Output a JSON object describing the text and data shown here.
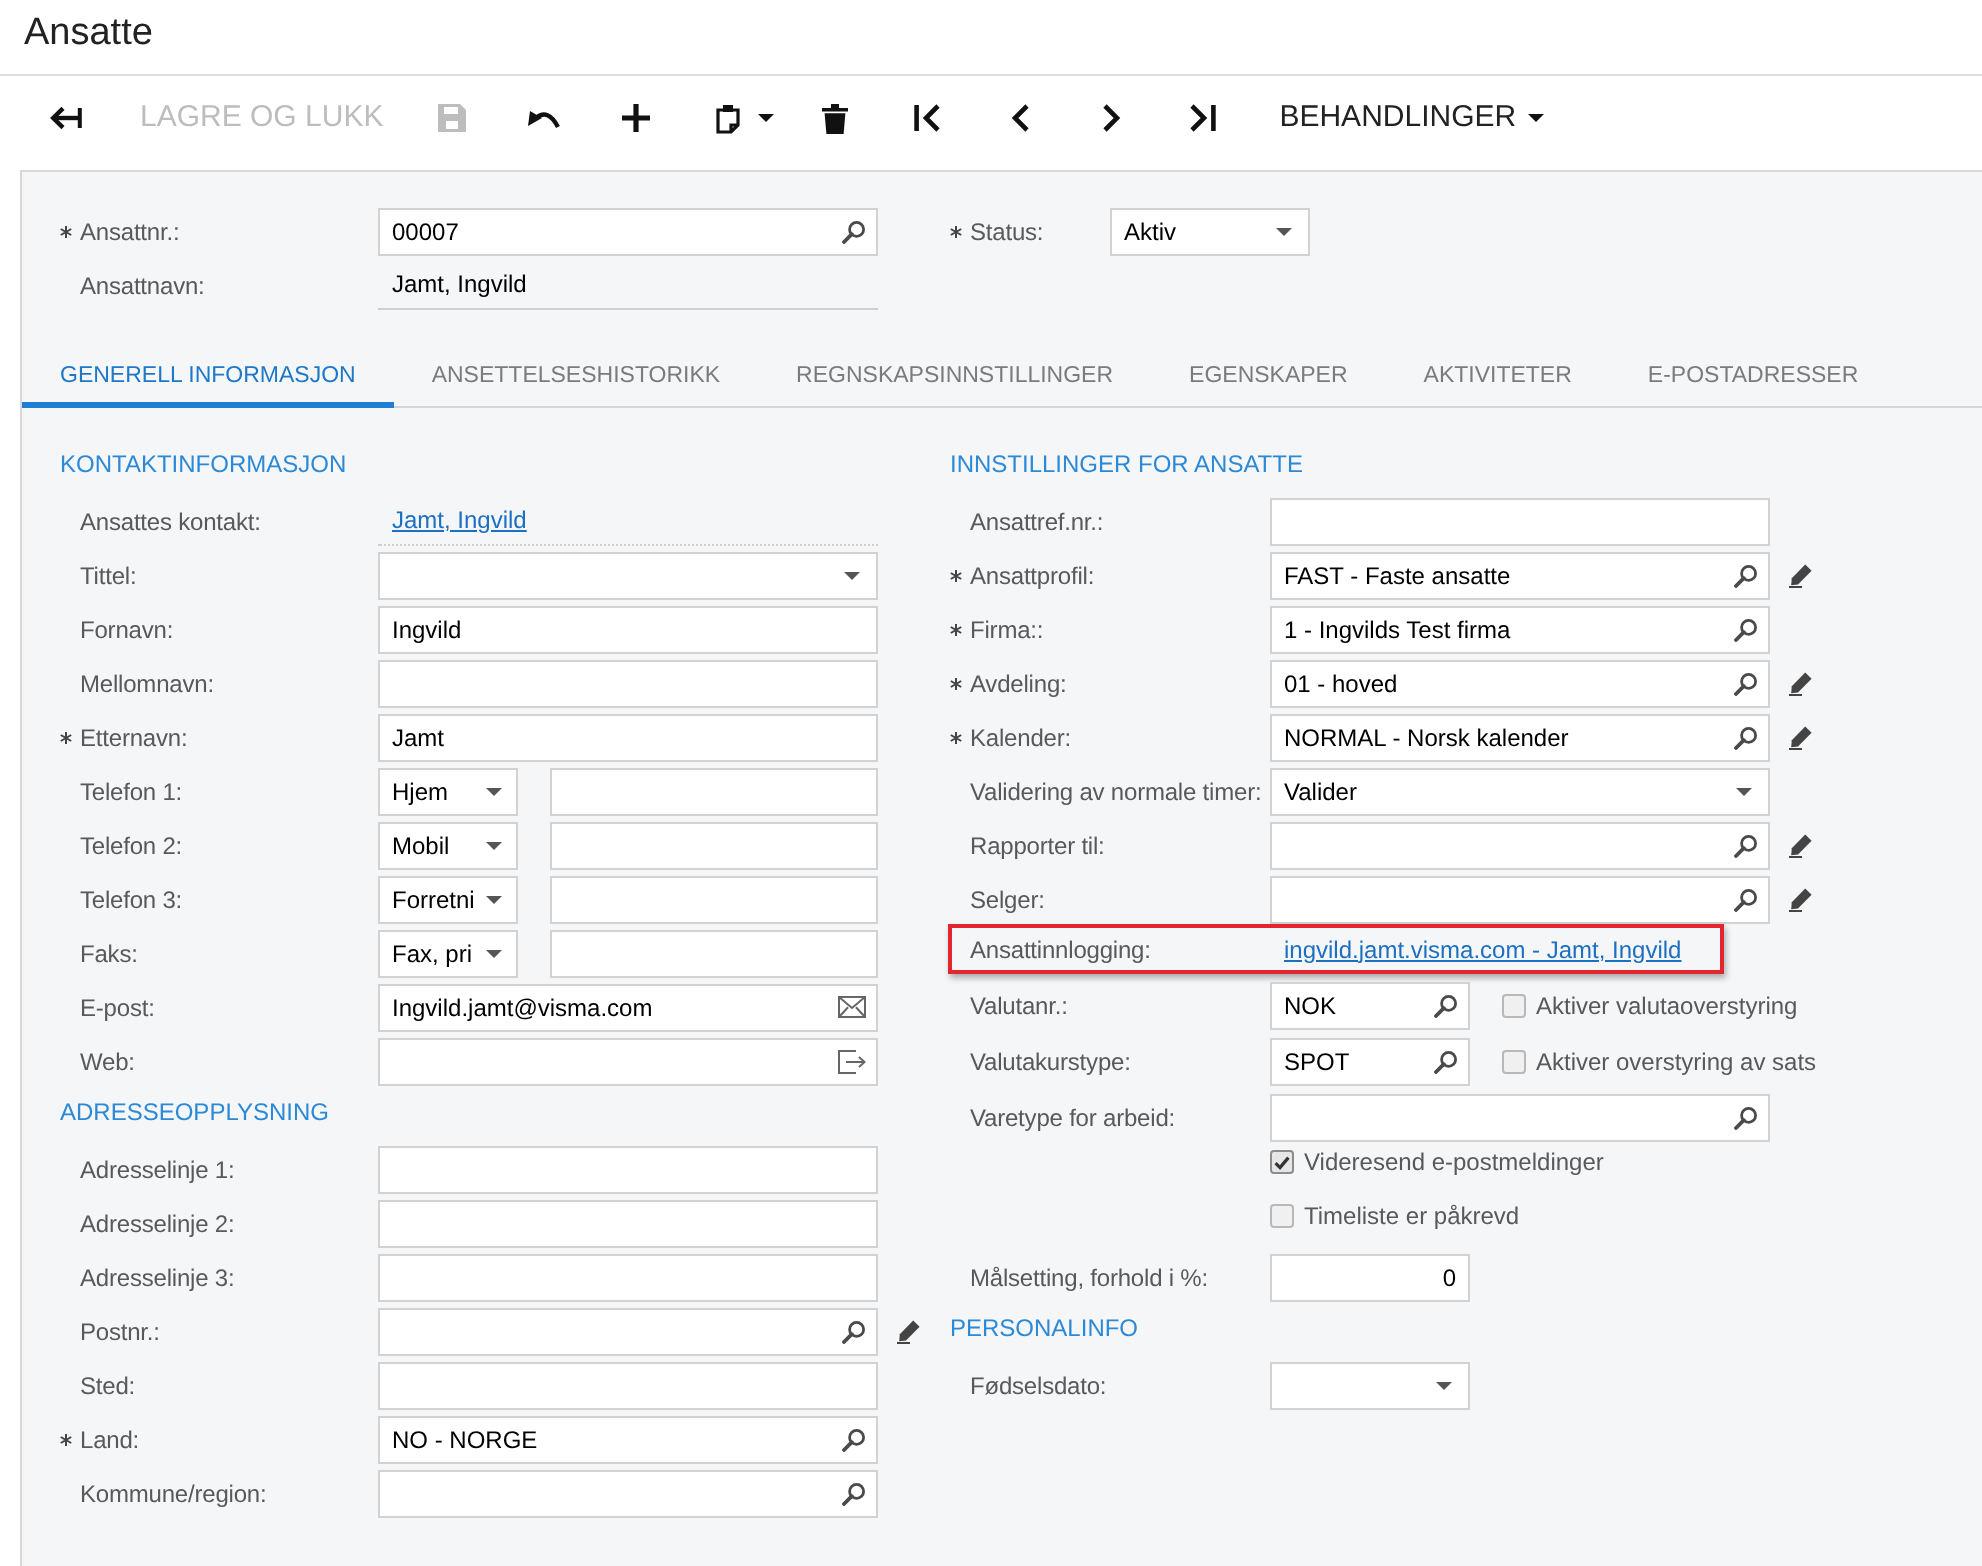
{
  "page": {
    "title": "Ansatte"
  },
  "toolbar": {
    "save_and_close": {
      "label": "LAGRE OG LUKK",
      "disabled": true
    },
    "save": {
      "disabled": true
    },
    "actions": {
      "label": "BEHANDLINGER"
    }
  },
  "header": {
    "fields": [
      {
        "kind": "lookup",
        "label": "Ansattnr.:",
        "required": true,
        "value": "00007"
      },
      {
        "kind": "readonly",
        "label": "Ansattnavn:",
        "required": false,
        "value": "Jamt, Ingvild"
      }
    ],
    "status": {
      "label": "Status:",
      "required": true,
      "value": "Aktiv"
    }
  },
  "tabs": [
    {
      "label": "GENERELL INFORMASJON",
      "selected": true
    },
    {
      "label": "ANSETTELSESHISTORIKK",
      "selected": false
    },
    {
      "label": "REGNSKAPSINNSTILLINGER",
      "selected": false
    },
    {
      "label": "EGENSKAPER",
      "selected": false
    },
    {
      "label": "AKTIVITETER",
      "selected": false
    },
    {
      "label": "E-POSTADRESSER",
      "selected": false
    }
  ],
  "left_sections": [
    {
      "title": "KONTAKTINFORMASJON",
      "fields": [
        {
          "kind": "link",
          "label": "Ansattes kontakt:",
          "required": false,
          "edit": false,
          "highlighted": false,
          "value": "Jamt, Ingvild"
        },
        {
          "kind": "select",
          "label": "Tittel:",
          "required": false,
          "edit": false
        },
        {
          "kind": "text",
          "label": "Fornavn:",
          "required": false,
          "edit": false,
          "value": "Ingvild"
        },
        {
          "kind": "text",
          "label": "Mellomnavn:",
          "required": false,
          "edit": false
        },
        {
          "kind": "text",
          "label": "Etternavn:",
          "required": true,
          "edit": false,
          "value": "Jamt"
        },
        {
          "kind": "phone",
          "label": "Telefon 1:",
          "required": false,
          "edit": false,
          "type": "Hjem"
        },
        {
          "kind": "phone",
          "label": "Telefon 2:",
          "required": false,
          "edit": false,
          "type": "Mobil"
        },
        {
          "kind": "phone",
          "label": "Telefon 3:",
          "required": false,
          "edit": false,
          "type": "Forretni"
        },
        {
          "kind": "phone",
          "label": "Faks:",
          "required": false,
          "edit": false,
          "type": "Fax, pri"
        },
        {
          "kind": "email",
          "label": "E-post:",
          "required": false,
          "edit": false,
          "value": "Ingvild.jamt@visma.com"
        },
        {
          "kind": "web",
          "label": "Web:",
          "required": false,
          "edit": false
        }
      ]
    },
    {
      "title": "ADRESSEOPPLYSNING",
      "fields": [
        {
          "kind": "text",
          "label": "Adresselinje 1:",
          "required": false,
          "edit": false
        },
        {
          "kind": "text",
          "label": "Adresselinje 2:",
          "required": false,
          "edit": false
        },
        {
          "kind": "text",
          "label": "Adresselinje 3:",
          "required": false,
          "edit": false
        },
        {
          "kind": "lookup",
          "label": "Postnr.:",
          "required": false,
          "edit": true
        },
        {
          "kind": "text",
          "label": "Sted:",
          "required": false,
          "edit": false
        },
        {
          "kind": "lookup",
          "label": "Land:",
          "required": true,
          "edit": false,
          "value": "NO - NORGE"
        },
        {
          "kind": "lookup",
          "label": "Kommune/region:",
          "required": false,
          "edit": false
        }
      ]
    }
  ],
  "right_sections": [
    {
      "title": "INNSTILLINGER FOR ANSATTE",
      "fields": [
        {
          "kind": "text",
          "label": "Ansattref.nr.:",
          "required": false,
          "edit": false
        },
        {
          "kind": "lookup",
          "label": "Ansattprofil:",
          "required": true,
          "edit": true,
          "value": "FAST - Faste ansatte"
        },
        {
          "kind": "lookup",
          "label": "Firma::",
          "required": true,
          "edit": false,
          "value": "1 - Ingvilds Test firma"
        },
        {
          "kind": "lookup",
          "label": "Avdeling:",
          "required": true,
          "edit": true,
          "value": "01 - hoved"
        },
        {
          "kind": "lookup",
          "label": "Kalender:",
          "required": true,
          "edit": true,
          "value": "NORMAL - Norsk kalender"
        },
        {
          "kind": "select",
          "label": "Validering av normale timer:",
          "required": false,
          "edit": false,
          "value": "Valider"
        },
        {
          "kind": "lookup",
          "label": "Rapporter til:",
          "required": false,
          "edit": true
        },
        {
          "kind": "lookup",
          "label": "Selger:",
          "required": false,
          "edit": true
        },
        {
          "kind": "link",
          "label": "Ansattinnlogging:",
          "required": false,
          "edit": false,
          "highlighted": true,
          "value": "ingvild.jamt.visma.com - Jamt, Ingvild"
        },
        {
          "kind": "short_lookup",
          "label": "Valutanr.:",
          "required": false,
          "edit": false,
          "value": "NOK",
          "option": {
            "label": "Aktiver valutaoverstyring",
            "checked": false
          }
        },
        {
          "kind": "short_lookup",
          "label": "Valutakurstype:",
          "required": false,
          "edit": false,
          "value": "SPOT",
          "option": {
            "label": "Aktiver overstyring av sats",
            "checked": false
          }
        },
        {
          "kind": "lookup",
          "label": "Varetype for arbeid:",
          "required": false,
          "edit": false
        },
        {
          "kind": "checkbox",
          "label": "Videresend e-postmeldinger",
          "checked": true
        },
        {
          "kind": "checkbox",
          "label": "Timeliste er påkrevd",
          "checked": false
        },
        {
          "kind": "number",
          "label": "Målsetting, forhold i %:",
          "required": false,
          "edit": false,
          "value": "0"
        }
      ]
    },
    {
      "title": "PERSONALINFO",
      "fields": [
        {
          "kind": "date",
          "label": "Fødselsdato:",
          "required": false,
          "edit": false
        }
      ]
    }
  ]
}
